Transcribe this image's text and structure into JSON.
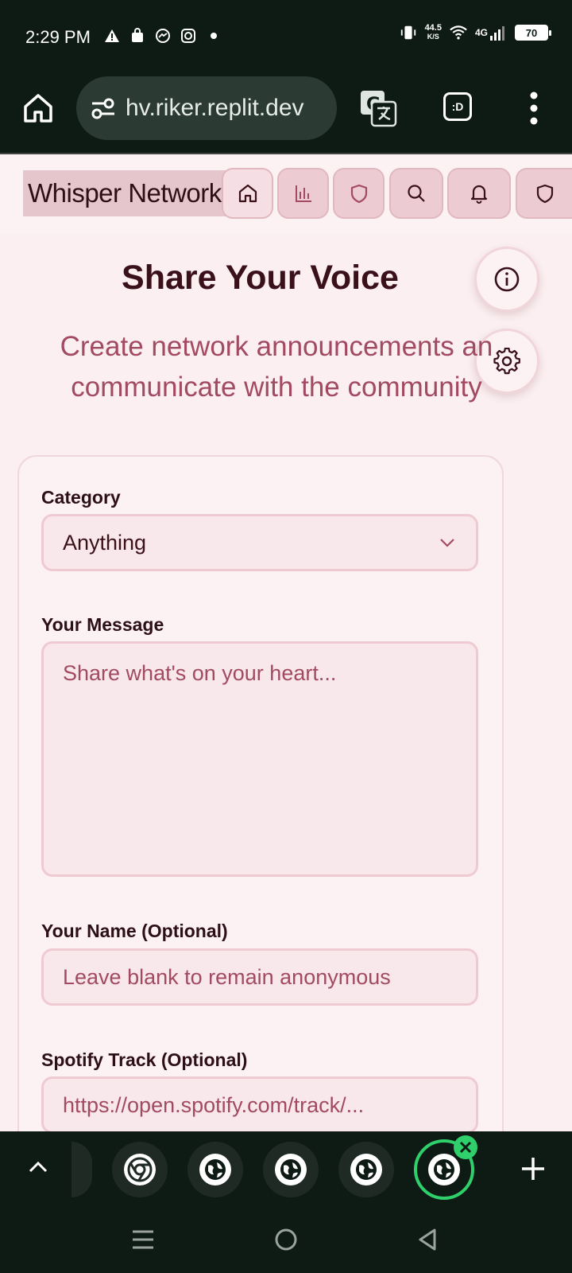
{
  "status_bar": {
    "time": "2:29 PM",
    "net_speed_value": "44.5",
    "net_speed_unit": "K/S",
    "network_type": "4G",
    "battery": "70"
  },
  "browser": {
    "url": "hv.riker.replit.dev",
    "tab_switcher_label": ":D"
  },
  "site_nav": {
    "brand": "Whisper Network",
    "buttons": [
      "home-icon",
      "bar-chart-icon",
      "shield-icon",
      "search-icon",
      "bell-icon",
      "shield-icon"
    ]
  },
  "main": {
    "title": "Share Your Voice",
    "subtitle_line1": "Create network announcements an",
    "subtitle_line2": "communicate with the community"
  },
  "form": {
    "category_label": "Category",
    "category_value": "Anything",
    "message_label": "Your Message",
    "message_placeholder": "Share what's on your heart...",
    "name_label": "Your Name (Optional)",
    "name_placeholder": "Leave blank to remain anonymous",
    "spotify_label": "Spotify Track (Optional)",
    "spotify_placeholder": "https://open.spotify.com/track/..."
  },
  "colors": {
    "accent": "#a24a63",
    "heading": "#3a101b",
    "page_bg": "#fbeff1",
    "active_tab": "#2fd06c"
  }
}
